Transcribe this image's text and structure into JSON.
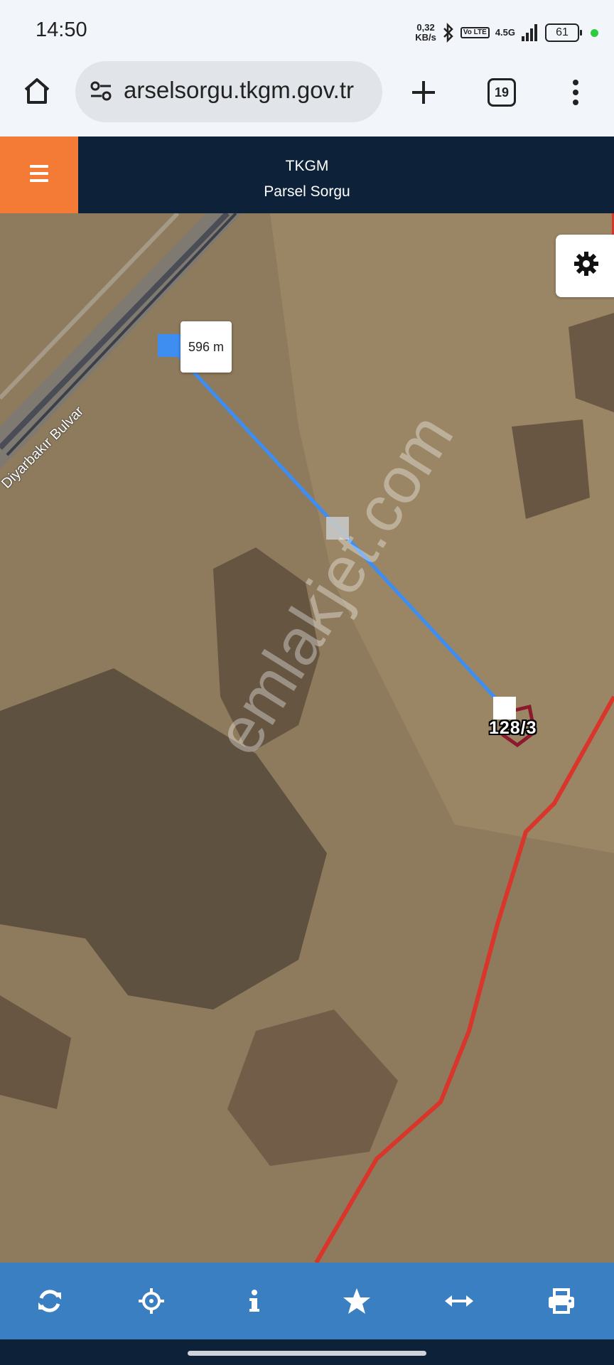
{
  "status_bar": {
    "time": "14:50",
    "speed_value": "0,32",
    "speed_unit": "KB/s",
    "volte": "Vo LTE",
    "network": "4.5G",
    "battery": "61"
  },
  "browser": {
    "url": "arselsorgu.tkgm.gov.tr",
    "tab_count": "19",
    "icons": [
      "home-icon",
      "tune-icon",
      "plus-icon",
      "tabs-icon",
      "more-vert-icon"
    ]
  },
  "app_header": {
    "title": "TKGM",
    "subtitle": "Parsel Sorgu",
    "menu_icon": "hamburger-icon",
    "accent_color": "#f47b36",
    "background_color": "#0d2238"
  },
  "map": {
    "measurement_label": "596 m",
    "parcel_label": "128/3",
    "road_label": "Diyarbakır Bulvar",
    "watermark": "emlakjet.com",
    "measure_line_color": "#3d8ef0",
    "boundary_color": "#d9352b",
    "parcel_color": "#8c1a2c"
  },
  "settings": {
    "icon": "gear-icon"
  },
  "bottom_toolbar": {
    "background_color": "#3a7fc2",
    "tools": [
      {
        "name": "refresh",
        "icon": "refresh-icon"
      },
      {
        "name": "locate",
        "icon": "crosshair-icon"
      },
      {
        "name": "info",
        "icon": "info-icon"
      },
      {
        "name": "favorite",
        "icon": "star-icon"
      },
      {
        "name": "measure",
        "icon": "arrows-horizontal-icon"
      },
      {
        "name": "print",
        "icon": "print-icon"
      }
    ]
  }
}
